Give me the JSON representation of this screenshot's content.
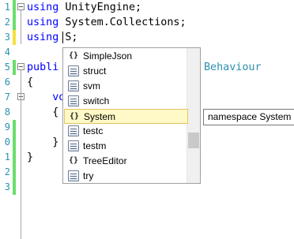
{
  "editor": {
    "lines": [
      {
        "num": "1",
        "parts": [
          {
            "t": "using",
            "c": "kw"
          },
          {
            "t": " UnityEngine;",
            "c": ""
          }
        ],
        "marker": "green",
        "fold": true
      },
      {
        "num": "2",
        "parts": [
          {
            "t": "using",
            "c": "kw"
          },
          {
            "t": " System.Collections;",
            "c": ""
          }
        ],
        "marker": "green"
      },
      {
        "num": "3",
        "parts": [
          {
            "t": "using",
            "c": "kw"
          },
          {
            "t": " S;",
            "c": ""
          }
        ],
        "marker": "yellow"
      },
      {
        "num": "4",
        "parts": [],
        "marker": ""
      },
      {
        "num": "5",
        "parts": [
          {
            "t": "publi",
            "c": "kw"
          }
        ],
        "marker": "green",
        "fold": true
      },
      {
        "num": "6",
        "parts": [
          {
            "t": "{",
            "c": ""
          }
        ],
        "marker": ""
      },
      {
        "num": "7",
        "parts": [
          {
            "t": "    vo",
            "c": "kw"
          }
        ],
        "marker": "",
        "fold": true
      },
      {
        "num": "8",
        "parts": [
          {
            "t": "    {",
            "c": ""
          }
        ],
        "marker": ""
      },
      {
        "num": "9",
        "parts": [],
        "marker": "green"
      },
      {
        "num": "0",
        "parts": [
          {
            "t": "    }",
            "c": ""
          }
        ],
        "marker": "green"
      },
      {
        "num": "1",
        "parts": [
          {
            "t": "}",
            "c": ""
          }
        ],
        "marker": "green"
      },
      {
        "num": "2",
        "parts": [],
        "marker": "green"
      },
      {
        "num": "3",
        "parts": [],
        "marker": "green"
      }
    ],
    "line5_trailing": "Behaviour"
  },
  "autocomplete": {
    "items": [
      {
        "label": "SimpleJson",
        "icon": "namespace-icon"
      },
      {
        "label": "struct",
        "icon": "keyword-icon"
      },
      {
        "label": "svm",
        "icon": "keyword-icon"
      },
      {
        "label": "switch",
        "icon": "keyword-icon"
      },
      {
        "label": "System",
        "icon": "namespace-icon",
        "selected": true
      },
      {
        "label": "testc",
        "icon": "keyword-icon"
      },
      {
        "label": "testm",
        "icon": "keyword-icon"
      },
      {
        "label": "TreeEditor",
        "icon": "namespace-icon"
      },
      {
        "label": "try",
        "icon": "keyword-icon"
      }
    ],
    "namespace_glyph": "{}",
    "tooltip": "namespace System"
  },
  "colors": {
    "keyword": "#0000ff",
    "type": "#2b91af",
    "selection": "#fef9c7",
    "change_saved": "#6ade6a",
    "change_unsaved": "#f6e03c"
  }
}
